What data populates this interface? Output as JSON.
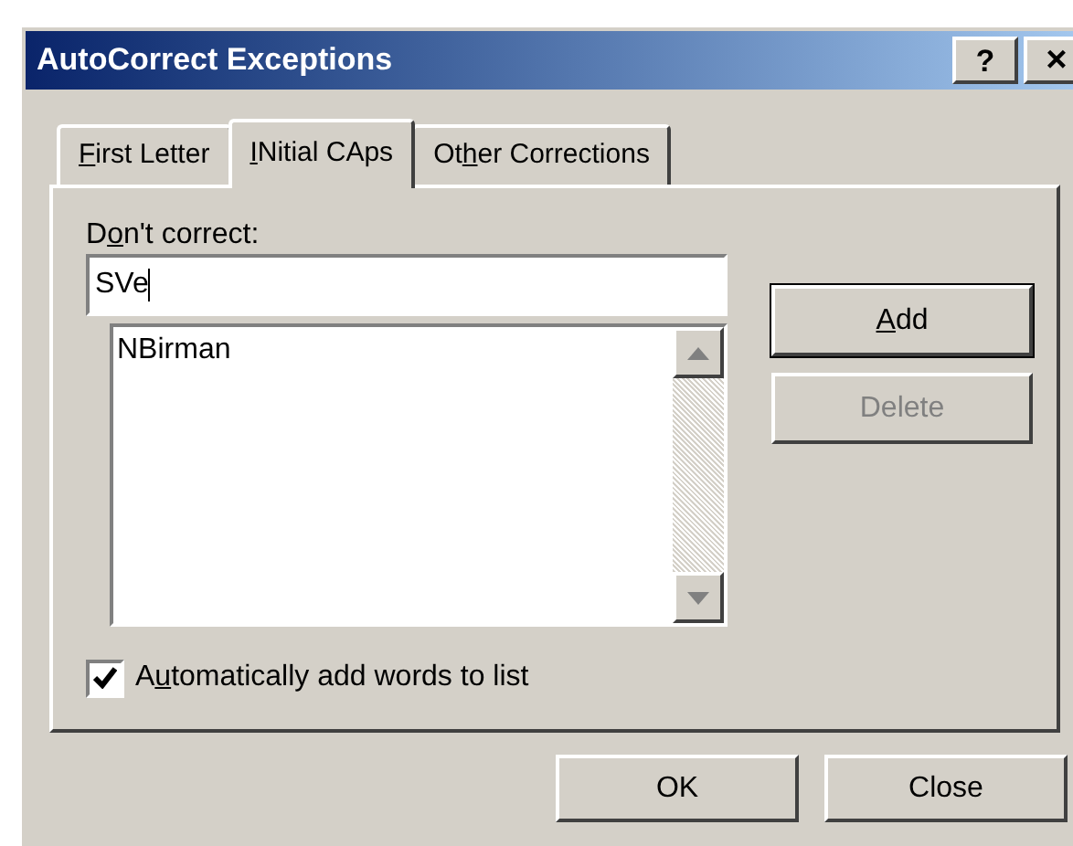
{
  "window": {
    "title": "AutoCorrect Exceptions",
    "help_button": "?",
    "close_button": "×"
  },
  "tabs": [
    {
      "label": [
        {
          "text": "F",
          "underlined": true
        },
        {
          "text": "irst Letter",
          "underlined": false
        }
      ],
      "selected": false
    },
    {
      "label": [
        {
          "text": "I",
          "underlined": true
        },
        {
          "text": "Nitial CAps",
          "underlined": false
        }
      ],
      "selected": true
    },
    {
      "label": [
        {
          "text": "Ot",
          "underlined": false
        },
        {
          "text": "h",
          "underlined": true
        },
        {
          "text": "er Corrections",
          "underlined": false
        }
      ],
      "selected": false
    }
  ],
  "field": {
    "label": [
      {
        "text": "D",
        "underlined": false
      },
      {
        "text": "o",
        "underlined": true
      },
      {
        "text": "n't correct:",
        "underlined": false
      }
    ],
    "value": "SVe"
  },
  "list": {
    "items": [
      "NBirman"
    ]
  },
  "side_buttons": [
    {
      "label": [
        {
          "text": "A",
          "underlined": true
        },
        {
          "text": "dd",
          "underlined": false
        }
      ],
      "disabled": false,
      "default": true
    },
    {
      "label": [
        {
          "text": "Delete",
          "underlined": false
        }
      ],
      "disabled": true,
      "default": false
    }
  ],
  "checkbox": {
    "label": [
      {
        "text": "A",
        "underlined": false
      },
      {
        "text": "u",
        "underlined": true
      },
      {
        "text": "tomatically add words to list",
        "underlined": false
      }
    ],
    "checked": true
  },
  "buttons": [
    {
      "label": "OK"
    },
    {
      "label": "Close"
    }
  ]
}
